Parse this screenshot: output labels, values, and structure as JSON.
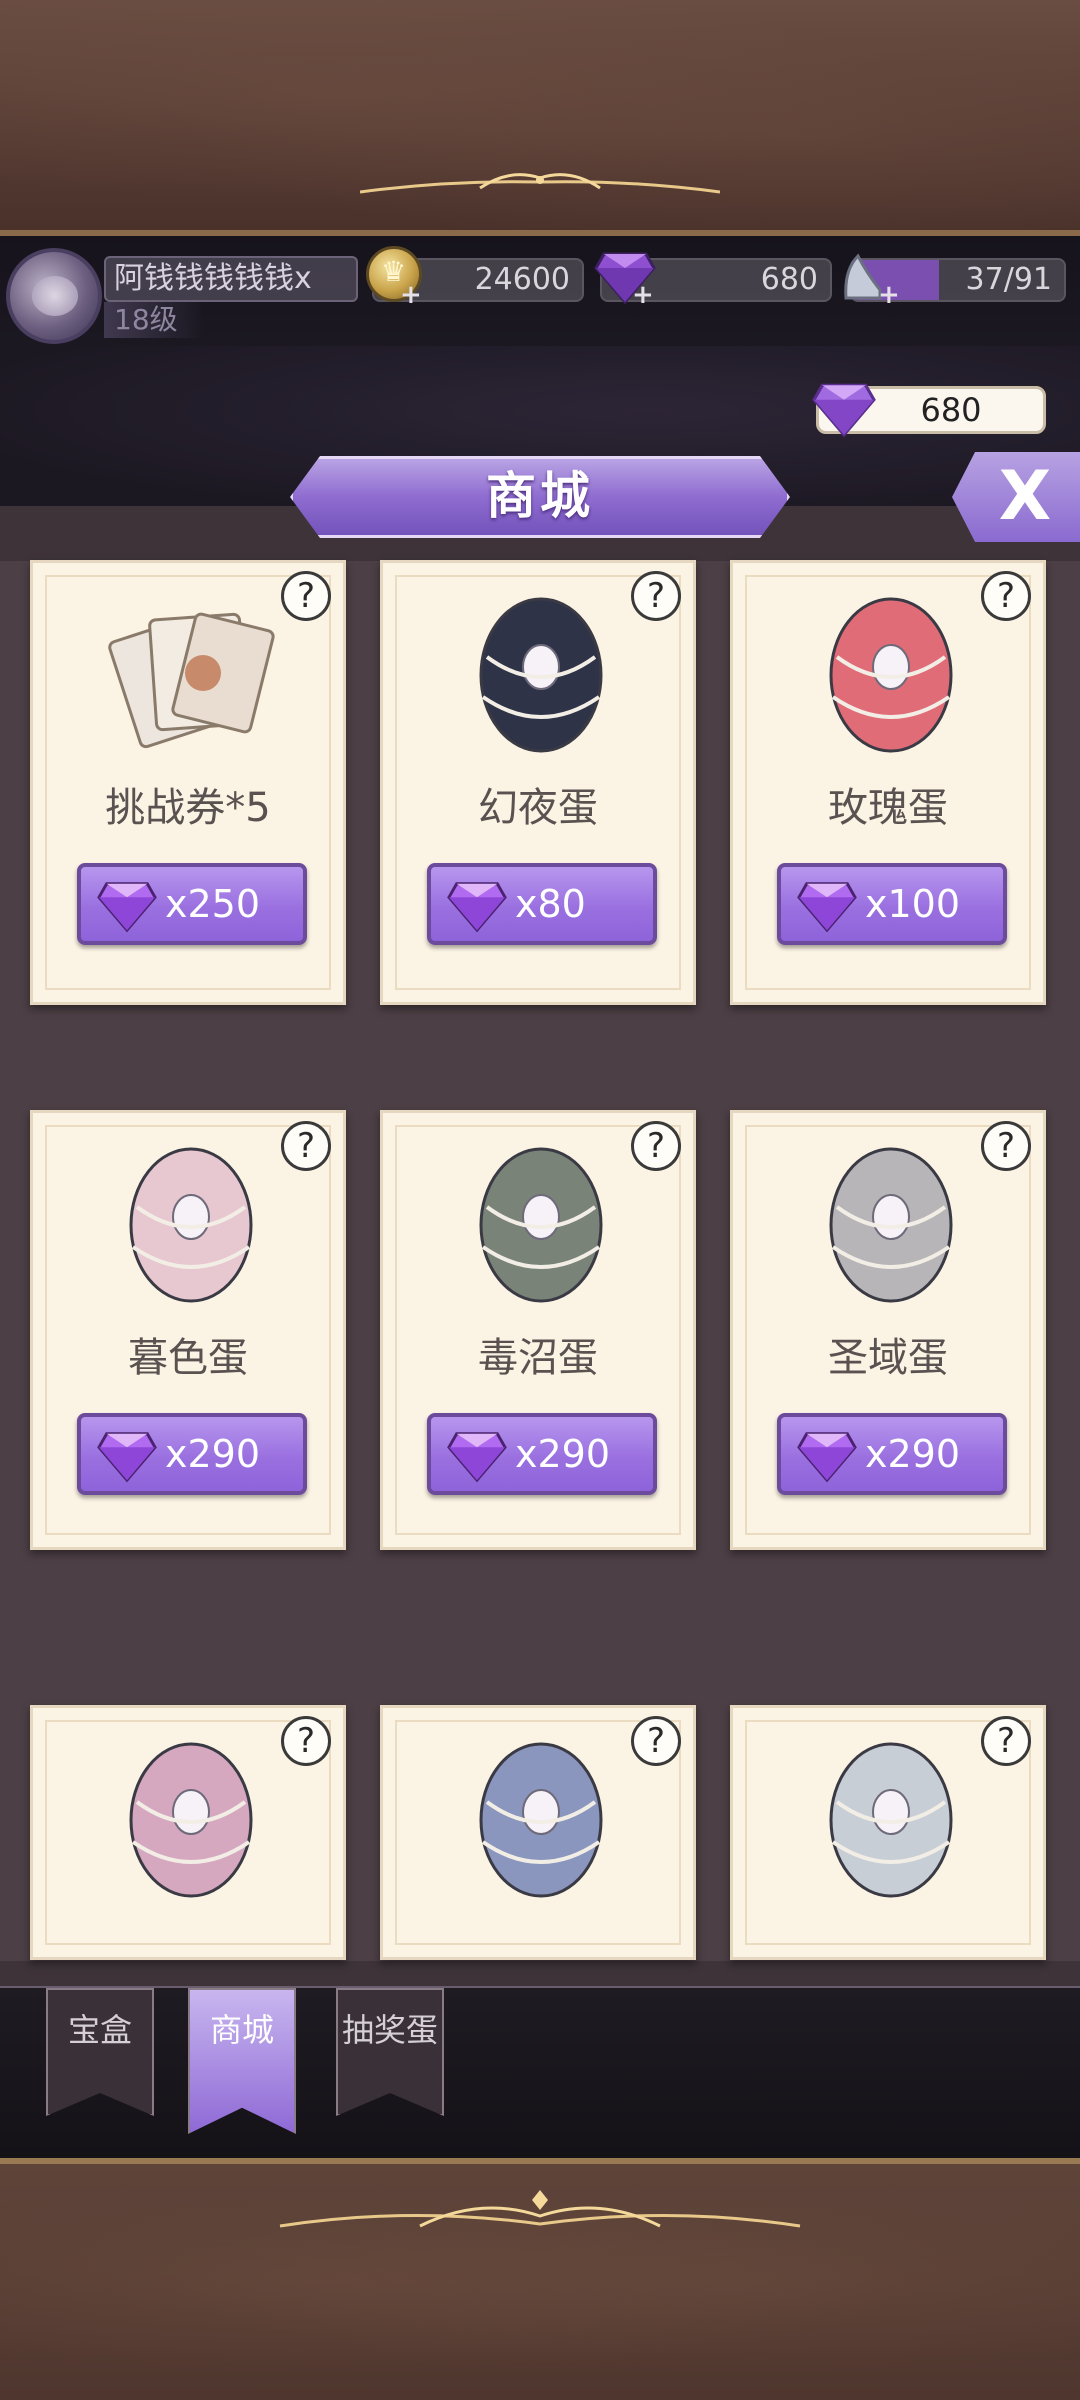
{
  "header": {
    "player_name": "阿钱钱钱钱钱x",
    "player_level": "18级",
    "gold": "24600",
    "diamonds": "680",
    "stamina": "37/91",
    "stamina_fraction": 0.41,
    "floating_diamonds": "680"
  },
  "shop": {
    "title": "商城",
    "close_label": "X",
    "items": [
      {
        "name": "挑战券*5",
        "price": "x250",
        "art": "ticket-bundle-icon",
        "color": "#c9b8a8"
      },
      {
        "name": "幻夜蛋",
        "price": "x80",
        "art": "night-egg-icon",
        "color": "#2f3348"
      },
      {
        "name": "玫瑰蛋",
        "price": "x100",
        "art": "rose-egg-icon",
        "color": "#e06c78"
      },
      {
        "name": "暮色蛋",
        "price": "x290",
        "art": "dusk-egg-icon",
        "color": "#e8c8d0"
      },
      {
        "name": "毒沼蛋",
        "price": "x290",
        "art": "swamp-egg-icon",
        "color": "#7a8378"
      },
      {
        "name": "圣域蛋",
        "price": "x290",
        "art": "sanctuary-egg-icon",
        "color": "#b8b5b8"
      },
      {
        "name": "",
        "price": "",
        "art": "pink-egg-icon",
        "color": "#d6a8c0"
      },
      {
        "name": "",
        "price": "",
        "art": "blue-egg-icon",
        "color": "#8b96be"
      },
      {
        "name": "",
        "price": "",
        "art": "silver-egg-icon",
        "color": "#c8ced6"
      }
    ]
  },
  "tabs": [
    {
      "label": "宝盒"
    },
    {
      "label": "商城"
    },
    {
      "label": "抽奖蛋"
    }
  ],
  "help_label": "?"
}
